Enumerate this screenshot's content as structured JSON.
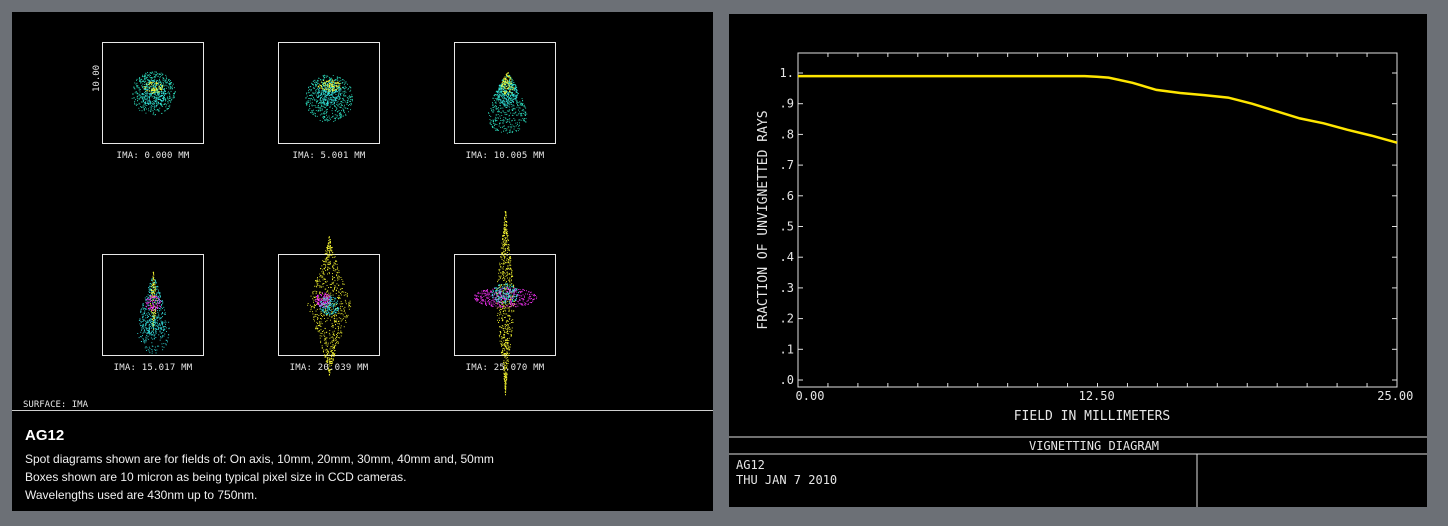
{
  "spot_panel": {
    "scale_label": "10.00",
    "surface_label": "SURFACE: IMA",
    "spots": [
      {
        "label": "IMA: 0.000 MM"
      },
      {
        "label": "IMA: 5.001 MM"
      },
      {
        "label": "IMA: 10.005 MM"
      },
      {
        "label": "IMA: 15.017 MM"
      },
      {
        "label": "IMA: 20.039 MM"
      },
      {
        "label": "IMA: 25.070 MM"
      }
    ],
    "wavelength_colors": {
      "blue": "#35e6e6",
      "green": "#2de0c0",
      "yellow": "#ffff33",
      "magenta": "#ff33ff"
    }
  },
  "caption": {
    "title": "AG12",
    "lines": [
      "Spot diagrams shown are for fields of: On axis, 10mm, 20mm, 30mm, 40mm and, 50mm",
      "Boxes shown are 10 micron as being typical pixel size in CCD cameras.",
      "Wavelengths used are 430nm up to 750nm."
    ]
  },
  "chart_data": {
    "type": "line",
    "title": "VIGNETTING DIAGRAM",
    "xlabel": "FIELD IN MILLIMETERS",
    "ylabel": "FRACTION OF UNVIGNETTED RAYS",
    "xlim": [
      0,
      25.07
    ],
    "ylim": [
      0,
      1
    ],
    "x_ticks": [
      "0.00",
      "12.50",
      "25.00"
    ],
    "y_ticks": [
      ".0",
      ".1",
      ".2",
      ".3",
      ".4",
      ".5",
      ".6",
      ".7",
      ".8",
      ".9",
      "1."
    ],
    "series_color": "#ffe600",
    "x": [
      0,
      2,
      4,
      6,
      8,
      10,
      12,
      12.5,
      13,
      14,
      15,
      16,
      17,
      18,
      19,
      20,
      21,
      22,
      23,
      24,
      25.07
    ],
    "values": [
      0.99,
      0.99,
      0.99,
      0.99,
      0.99,
      0.99,
      0.99,
      0.988,
      0.985,
      0.968,
      0.945,
      0.935,
      0.928,
      0.92,
      0.9,
      0.876,
      0.852,
      0.836,
      0.815,
      0.796,
      0.773,
      0.73
    ],
    "footer_name": "AG12",
    "footer_date": "THU JAN 7 2010"
  }
}
